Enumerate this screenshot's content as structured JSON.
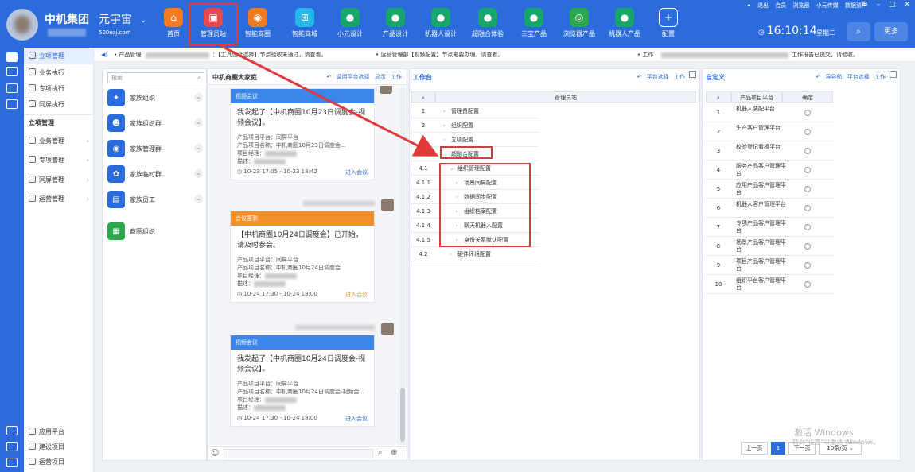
{
  "header": {
    "company": "中机集团",
    "universe": "元宇宙",
    "universe_url": "520ezj.com",
    "nav": [
      {
        "label": "首页",
        "icon": "home-icon",
        "color": "#f47b20",
        "glyph": "⌂"
      },
      {
        "label": "管理员站",
        "icon": "admin-icon",
        "color": "#e5484d",
        "glyph": "▣"
      },
      {
        "label": "智能商圈",
        "icon": "business-circle-icon",
        "color": "#f07a22",
        "glyph": "◉"
      },
      {
        "label": "智能商城",
        "icon": "shopping-cart-icon",
        "color": "#25b7e8",
        "glyph": "⊞"
      },
      {
        "label": "小元设计",
        "icon": "robot-icon",
        "color": "#17a66a",
        "glyph": "●"
      },
      {
        "label": "产品设计",
        "icon": "robot-icon",
        "color": "#17a66a",
        "glyph": "●"
      },
      {
        "label": "机器人设计",
        "icon": "robot-icon",
        "color": "#17a66a",
        "glyph": "●"
      },
      {
        "label": "超融合体验",
        "icon": "robot-icon",
        "color": "#17a66a",
        "glyph": "●"
      },
      {
        "label": "三宝产品",
        "icon": "robot-icon",
        "color": "#17a66a",
        "glyph": "●"
      },
      {
        "label": "浏览器产品",
        "icon": "browser-logo-icon",
        "color": "#2aa84a",
        "glyph": "◎"
      },
      {
        "label": "机器人产品",
        "icon": "robot-icon",
        "color": "#17a66a",
        "glyph": "●"
      },
      {
        "label": "配置",
        "icon": "plus-icon",
        "color": "#2c6bdc",
        "glyph": "+"
      }
    ],
    "window_links": [
      "退出",
      "会员",
      "浏览器",
      "小元传媒",
      "数据资产"
    ],
    "time": "16:10:14",
    "weekday": "星期二",
    "more_label": "更多"
  },
  "sidebar": {
    "top_items": [
      {
        "label": "立项管理",
        "active": true
      },
      {
        "label": "业务执行",
        "active": false
      },
      {
        "label": "专项执行",
        "active": false
      },
      {
        "label": "同屏执行",
        "active": false
      }
    ],
    "section_title": "立项管理",
    "groups": [
      "业务管理",
      "专项管理",
      "同屏管理",
      "运营管理"
    ],
    "bottom_items": [
      "应用平台",
      "建设项目",
      "运营项目"
    ]
  },
  "notice": {
    "items": [
      "• 产品管理",
      "：【工具设计选择】节点验收未通过，请查看。",
      "• 运营管理部【视频配置】节点需要办理，请查看。",
      "• 工作",
      "工作报告已提交，请验收。"
    ]
  },
  "org_panel": {
    "search_placeholder": "搜索",
    "items": [
      {
        "label": "家族组织",
        "color": "#2c6bdc",
        "glyph": "✦"
      },
      {
        "label": "家族组织群",
        "color": "#2c6bdc",
        "glyph": "☻"
      },
      {
        "label": "家族管理群",
        "color": "#2c6bdc",
        "glyph": "◉"
      },
      {
        "label": "家族临时群",
        "color": "#2c6bdc",
        "glyph": "✿"
      },
      {
        "label": "家族员工",
        "color": "#2c6bdc",
        "glyph": "▤"
      },
      {
        "label": "商圈组织",
        "color": "#2aa84a",
        "glyph": "▦"
      }
    ]
  },
  "chat": {
    "title": "中机商圈大家庭",
    "actions": [
      "调用平台选择",
      "显示",
      "工作"
    ],
    "cards": [
      {
        "head": "视频会议",
        "head_color": "#3b86e8",
        "msg": "我发起了【中机商圈10月23日调度会-视频会议】。",
        "platform": "产品项目平台：同屏平台",
        "name": "产品项目名称：中机商圈10月23日调度会...",
        "manager": "项目经理：",
        "desc": "描述：",
        "time": "10-23 17:05 - 10-23 18:42",
        "enter": "进入会议",
        "enter_style": "blue"
      },
      {
        "head": "会议签到",
        "head_color": "#f0902d",
        "msg": "【中机商圈10月24日调度会】已开始，请及时参会。",
        "platform": "产品项目平台：同屏平台",
        "name": "产品项目名称：中机商圈10月24日调度会",
        "manager": "项目经理：",
        "desc": "描述：",
        "time": "10-24 17:30 - 10-24 18:00",
        "enter": "进入会议",
        "enter_style": "orange"
      },
      {
        "head": "视频会议",
        "head_color": "#3b86e8",
        "msg": "我发起了【中机商圈10月24日调度会-视频会议】。",
        "platform": "产品项目平台：同屏平台",
        "name": "产品项目名称：中机商圈10月24日调度会-视频会...",
        "manager": "项目经理：",
        "desc": "描述：",
        "time": "10-24 17:30 - 10-24 18:00",
        "enter": "进入会议",
        "enter_style": "blue"
      }
    ]
  },
  "workbench": {
    "title": "工作台",
    "actions": [
      "平台选择",
      "工作"
    ],
    "column": "管理员站",
    "rows": [
      {
        "num": "1",
        "label": "管理员配置",
        "level": 0,
        "open": false
      },
      {
        "num": "2",
        "label": "组织配置",
        "level": 0,
        "open": false
      },
      {
        "num": "3",
        "label": "立项配置",
        "level": 0,
        "open": false
      },
      {
        "num": "4",
        "label": "超融合配置",
        "level": 0,
        "open": true
      },
      {
        "num": "4.1",
        "label": "组织管理配置",
        "level": 1,
        "open": true
      },
      {
        "num": "4.1.1",
        "label": "场景同屏配置",
        "level": 2,
        "open": false
      },
      {
        "num": "4.1.2",
        "label": "数据同步配置",
        "level": 2,
        "open": false
      },
      {
        "num": "4.1.3",
        "label": "组织档案配置",
        "level": 2,
        "open": false
      },
      {
        "num": "4.1.4",
        "label": "聊天机器人配置",
        "level": 2,
        "open": false
      },
      {
        "num": "4.1.5",
        "label": "身份关系默认配置",
        "level": 2,
        "open": false
      },
      {
        "num": "4.2",
        "label": "硬件环境配置",
        "level": 1,
        "open": false
      }
    ]
  },
  "custom": {
    "title": "自定义",
    "actions": [
      "导导航",
      "平台选择",
      "工作"
    ],
    "col_platform": "产品项目平台",
    "col_confirm": "确定",
    "rows": [
      {
        "num": "1",
        "label": "机器人装配平台"
      },
      {
        "num": "2",
        "label": "生产客户管理平台"
      },
      {
        "num": "3",
        "label": "校验登记看板平台"
      },
      {
        "num": "4",
        "label": "服务产品客户管理平台"
      },
      {
        "num": "5",
        "label": "应用产品客户管理平台"
      },
      {
        "num": "6",
        "label": "机器人客户管理平台"
      },
      {
        "num": "7",
        "label": "专项产品客户管理平台"
      },
      {
        "num": "8",
        "label": "场景产品客户管理平台"
      },
      {
        "num": "9",
        "label": "项目产品客户管理平台"
      },
      {
        "num": "10",
        "label": "组织平台客户管理平台"
      }
    ],
    "pager": {
      "prev": "上一页",
      "current": "1",
      "next": "下一页",
      "size": "10条/页"
    }
  },
  "watermark": {
    "line1": "激活 Windows",
    "line2": "转到\"设置\"以激活 Windows。"
  }
}
